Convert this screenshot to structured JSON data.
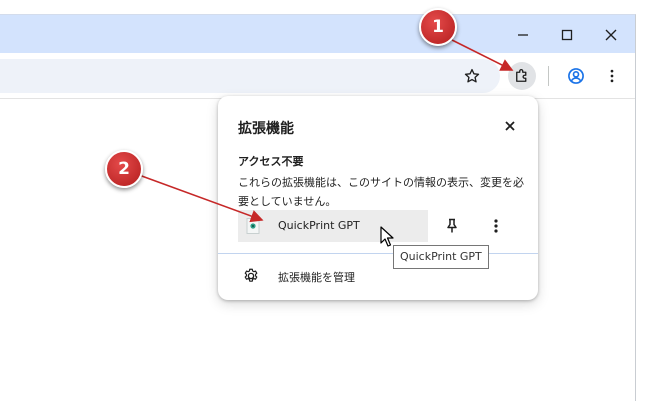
{
  "popup": {
    "title": "拡張機能",
    "section_title": "アクセス不要",
    "section_desc": "これらの拡張機能は、このサイトの情報の表示、変更を必要としていません。",
    "extension": {
      "name": "QuickPrint GPT",
      "icon": "quickprint-icon"
    },
    "manage_label": "拡張機能を管理"
  },
  "tooltip": "QuickPrint GPT",
  "annotations": [
    {
      "label": "1"
    },
    {
      "label": "2"
    }
  ],
  "colors": {
    "titlebar": "#d3e3fd",
    "omnibox": "#eef2f9",
    "annotation_red": "#c62828",
    "profile_blue": "#1a73e8"
  }
}
